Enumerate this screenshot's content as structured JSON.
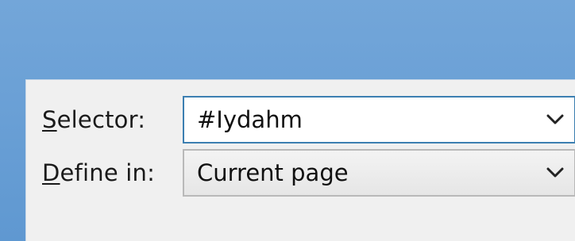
{
  "selector": {
    "label_accel": "S",
    "label_rest": "elector:",
    "value": "#Iydahm",
    "dropdown_icon": "chevron-down-icon"
  },
  "define_in": {
    "label_accel": "D",
    "label_rest": "efine in:",
    "value": "Current page",
    "dropdown_icon": "chevron-down-icon"
  },
  "colors": {
    "title_bar": "#6a9fd3",
    "dialog_bg": "#f0f0f0",
    "focus_border": "#3c7fb1"
  }
}
